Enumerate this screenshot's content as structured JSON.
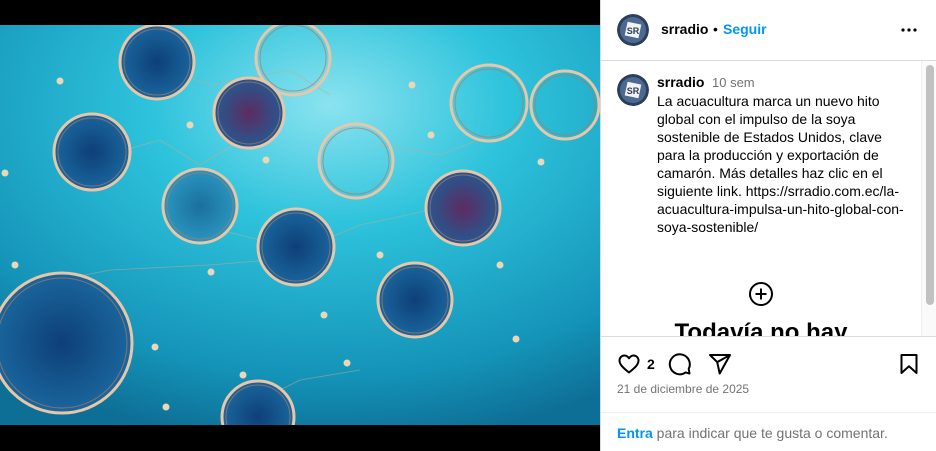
{
  "post": {
    "username": "srradio",
    "separator": "•",
    "follow_label": "Seguir",
    "comment_username": "srradio",
    "comment_time": "10 sem",
    "caption": "La acuacultura marca un nuevo hito global con el impulso de la soya sostenible de Estados Unidos, clave para la producción y exportación de camarón. Más detalles haz clic en el siguiente link. https://srradio.com.ec/la-acuacultura-impulsa-un-hito-global-con-soya-sostenible/",
    "empty_comments_title": "Todavía no hay",
    "likes": "2",
    "date": "21 de diciembre de 2025",
    "login_link": "Entra",
    "login_rest": " para indicar que te gusta o comentar."
  },
  "icons": {
    "more": "more-options-icon",
    "like": "heart-icon",
    "comment": "comment-icon",
    "share": "share-icon",
    "save": "bookmark-icon",
    "add": "add-circle-icon"
  },
  "colors": {
    "accent": "#0095f6",
    "water": "#2fb6d4",
    "muted": "#737373"
  }
}
